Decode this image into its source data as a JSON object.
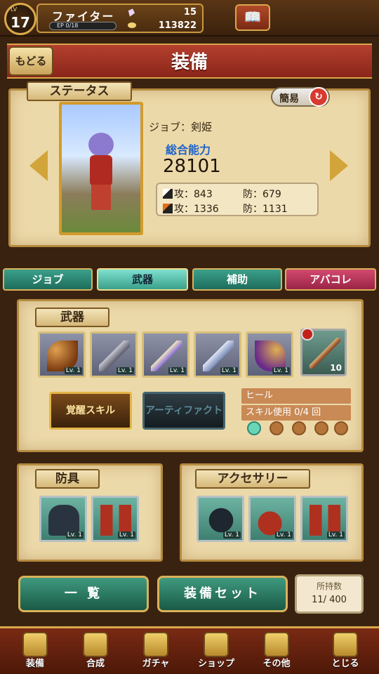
{
  "player": {
    "lv_label": "LV",
    "level": "17",
    "class_name": "ファイター",
    "ep_label": "EP 0/18",
    "ep_fraction": 0,
    "gems": "15",
    "coins": "113822"
  },
  "header": {
    "back_label": "もどる",
    "title": "装備"
  },
  "status": {
    "tag": "ステータス",
    "simple_label": "簡易",
    "job_line": "ジョブ：剣姫",
    "power_label": "総合能力",
    "power_value": "28101",
    "phys_atk": "攻：843",
    "phys_def": "防：679",
    "mag_atk": "攻：1336",
    "mag_def": "防：1131"
  },
  "tabs": [
    {
      "label": "ジョブ"
    },
    {
      "label": "武器"
    },
    {
      "label": "補助"
    },
    {
      "label": "アバコレ"
    }
  ],
  "weapons": {
    "tag": "武器",
    "slots": [
      {
        "lv": "Lv. 1",
        "icon": "bow-icon"
      },
      {
        "lv": "Lv. 1",
        "icon": "axe-icon"
      },
      {
        "lv": "Lv. 1",
        "icon": "sword-icon"
      },
      {
        "lv": "Lv. 1",
        "icon": "twin-blade-icon"
      },
      {
        "lv": "Lv. 1",
        "icon": "bow-icon"
      }
    ],
    "support_count": "10",
    "awaken_label": "覚醒スキル",
    "artifact_label": "アーティファクト",
    "skill_name": "ヒール",
    "skill_use": "スキル使用  0/4 回"
  },
  "armor": {
    "tag": "防具",
    "slots": [
      {
        "lv": "Lv. 1",
        "icon": "armor-icon"
      },
      {
        "lv": "Lv. 1",
        "icon": "boots-icon"
      }
    ]
  },
  "accessory": {
    "tag": "アクセサリー",
    "slots": [
      {
        "lv": "Lv. 1",
        "icon": "bracelet-icon"
      },
      {
        "lv": "Lv. 1",
        "icon": "gauntlet-icon"
      },
      {
        "lv": "Lv. 1",
        "icon": "boots-icon"
      }
    ]
  },
  "footer_buttons": {
    "list_label": "一 覧",
    "set_label": "装備セット",
    "count_label": "所持数",
    "count_value": "11/ 400"
  },
  "nav": [
    {
      "label": "装備",
      "icon": "equip-icon"
    },
    {
      "label": "合成",
      "icon": "hammer-icon"
    },
    {
      "label": "ガチャ",
      "icon": "gacha-icon"
    },
    {
      "label": "ショップ",
      "icon": "crystal-icon"
    },
    {
      "label": "その他",
      "icon": "gear-icon"
    },
    {
      "label": "とじる",
      "icon": "close-icon"
    }
  ]
}
